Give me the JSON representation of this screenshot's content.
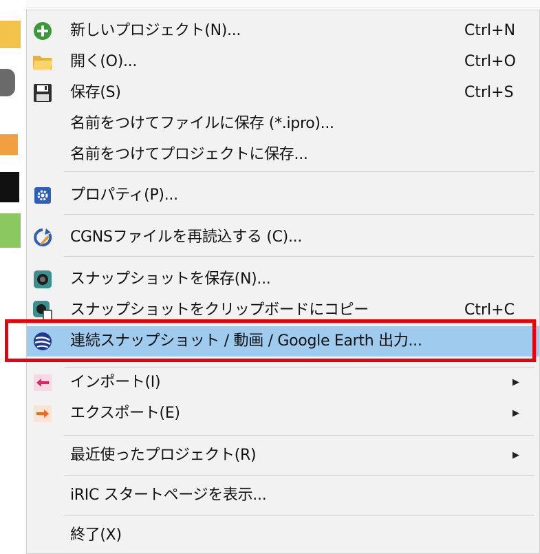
{
  "menu": {
    "items": [
      {
        "label": "新しいプロジェクト(N)...",
        "shortcut": "Ctrl+N",
        "icon": "new-project-icon"
      },
      {
        "label": "開く(O)...",
        "shortcut": "Ctrl+O",
        "icon": "folder-open-icon"
      },
      {
        "label": "保存(S)",
        "shortcut": "Ctrl+S",
        "icon": "floppy-save-icon"
      },
      {
        "label": "名前をつけてファイルに保存 (*.ipro)...",
        "shortcut": "",
        "icon": ""
      },
      {
        "label": "名前をつけてプロジェクトに保存...",
        "shortcut": "",
        "icon": ""
      },
      {
        "label": "プロパティ(P)...",
        "shortcut": "",
        "icon": "properties-gear-icon"
      },
      {
        "label": "CGNSファイルを再読込する (C)...",
        "shortcut": "",
        "icon": "reload-icon"
      },
      {
        "label": "スナップショットを保存(N)...",
        "shortcut": "",
        "icon": "camera-icon"
      },
      {
        "label": "スナップショットをクリップボードにコピー",
        "shortcut": "Ctrl+C",
        "icon": "camera-clipboard-icon"
      },
      {
        "label": "連続スナップショット / 動画 / Google Earth 出力...",
        "shortcut": "",
        "icon": "google-earth-icon",
        "highlighted": true
      },
      {
        "label": "インポート(I)",
        "shortcut": "",
        "icon": "import-arrow-icon",
        "submenu": true
      },
      {
        "label": "エクスポート(E)",
        "shortcut": "",
        "icon": "export-arrow-icon",
        "submenu": true
      },
      {
        "label": "最近使ったプロジェクト(R)",
        "shortcut": "",
        "icon": "",
        "submenu": true
      },
      {
        "label": "iRIC スタートページを表示...",
        "shortcut": "",
        "icon": ""
      },
      {
        "label": "終了(X)",
        "shortcut": "",
        "icon": ""
      }
    ],
    "submenu_glyph": "▶"
  },
  "colors": {
    "highlight": "#9fcbef",
    "annotation": "#e8000b",
    "menu_bg": "#f2f2f2"
  }
}
